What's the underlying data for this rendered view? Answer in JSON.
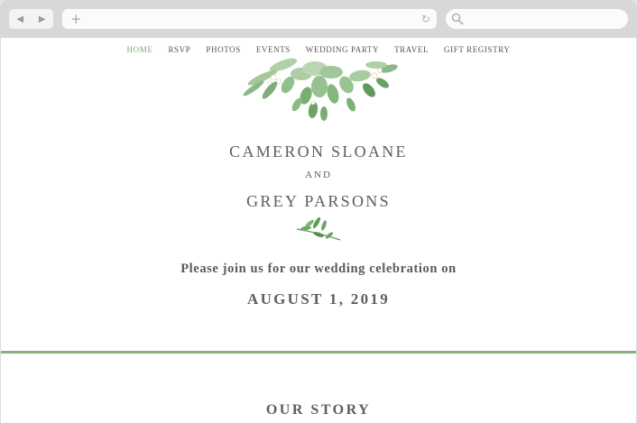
{
  "nav": {
    "items": [
      {
        "label": "HOME",
        "active": true
      },
      {
        "label": "RSVP",
        "active": false
      },
      {
        "label": "PHOTOS",
        "active": false
      },
      {
        "label": "EVENTS",
        "active": false
      },
      {
        "label": "WEDDING PARTY",
        "active": false
      },
      {
        "label": "TRAVEL",
        "active": false
      },
      {
        "label": "GIFT REGISTRY",
        "active": false
      }
    ]
  },
  "hero": {
    "name_1": "CAMERON SLOANE",
    "and": "AND",
    "name_2": "GREY PARSONS",
    "invitation": "Please join us for our wedding celebration on",
    "date": "AUGUST 1, 2019"
  },
  "story": {
    "heading": "OUR STORY"
  },
  "colors": {
    "accent_green": "#8cb07c",
    "active_nav": "#7daa72",
    "text": "#5e5e5e"
  },
  "icons": [
    "back-arrow-icon",
    "forward-arrow-icon",
    "new-tab-plus-icon",
    "reload-icon",
    "search-icon",
    "floral-bouquet-icon",
    "leaf-sprig-icon"
  ]
}
